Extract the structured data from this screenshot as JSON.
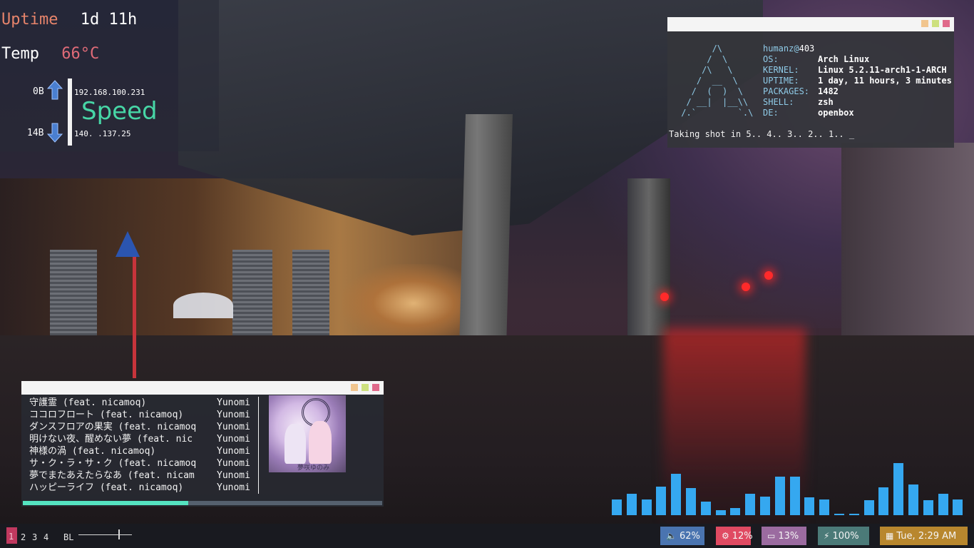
{
  "conky": {
    "uptime_label": "Uptime",
    "uptime_value": "1d 11h",
    "temp_label": "Temp",
    "temp_value": "66°C",
    "up_amount": "0B",
    "down_amount": "14B",
    "local_ip": "192.168.100.231",
    "public_ip": "140. .137.25",
    "speed_label": "Speed"
  },
  "neofetch": {
    "ascii_art": "       /\\\n      /  \\\n     /\\   \\\n    /  __  \\\n   /  (  )  \\\n  / __|  |__\\\\\n /.`        `.\\",
    "user": "humanz",
    "at": "@",
    "host": "403",
    "fields": [
      {
        "key": "OS:",
        "value": "Arch Linux"
      },
      {
        "key": "KERNEL:",
        "value": "Linux 5.2.11-arch1-1-ARCH"
      },
      {
        "key": "UPTIME:",
        "value": "1 day, 11 hours, 3 minutes"
      },
      {
        "key": "PACKAGES:",
        "value": "1482"
      },
      {
        "key": "SHELL:",
        "value": "zsh"
      },
      {
        "key": "DE:",
        "value": "openbox"
      }
    ],
    "countdown": "Taking shot in 5.. 4.. 3.. 2.. 1.. _"
  },
  "player": {
    "tracks": [
      {
        "title": "守護霊 (feat. nicamoq)",
        "artist": "Yunomi"
      },
      {
        "title": "ココロフロート (feat. nicamoq)",
        "artist": "Yunomi"
      },
      {
        "title": "ダンスフロアの果実 (feat. nicamoq",
        "artist": "Yunomi"
      },
      {
        "title": "明けない夜、醒めない夢 (feat. nic",
        "artist": "Yunomi"
      },
      {
        "title": "神様の渦 (feat. nicamoq)",
        "artist": "Yunomi"
      },
      {
        "title": "サ・ク・ラ・サ・ク (feat. nicamoq",
        "artist": "Yunomi"
      },
      {
        "title": "夢でまたあえたらなあ (feat. nicam",
        "artist": "Yunomi"
      },
      {
        "title": "ハッピーライフ (feat. nicamoq)",
        "artist": "Yunomi"
      }
    ],
    "cover_text": "夢咲ゆのみ",
    "progress": 0.46
  },
  "visualizer": {
    "color": "#35a8f0",
    "levels": [
      0.27,
      0.37,
      0.27,
      0.5,
      0.73,
      0.47,
      0.24,
      0.09,
      0.13,
      0.37,
      0.33,
      0.67,
      0.67,
      0.31,
      0.27,
      0.03,
      0.03,
      0.26,
      0.49,
      0.91,
      0.54,
      0.26,
      0.37,
      0.27
    ]
  },
  "bar": {
    "workspaces": [
      "1",
      "2",
      "3",
      "4"
    ],
    "active_workspace": "1",
    "backlight_label": "BL",
    "backlight_level": 0.77,
    "modules": [
      {
        "icon": "volume-icon",
        "glyph": "🔈",
        "label": "62%",
        "color": "#4a74b0"
      },
      {
        "icon": "cpu-icon",
        "glyph": "⚙",
        "label": "12%",
        "color": "#e04a62"
      },
      {
        "icon": "memory-icon",
        "glyph": "▭",
        "label": "13%",
        "color": "#9b6ba0"
      },
      {
        "icon": "battery-icon",
        "glyph": "⚡",
        "label": "100%",
        "color": "#4b7a78"
      },
      {
        "icon": "calendar-icon",
        "glyph": "▦",
        "label": "Tue,  2:29 AM",
        "color": "#b8872e"
      }
    ]
  },
  "colors": {
    "accent_green": "#47d6a6",
    "accent_pink": "#e06b78",
    "accent_salmon": "#e7846b",
    "progress_fill": "#55e3c0"
  }
}
